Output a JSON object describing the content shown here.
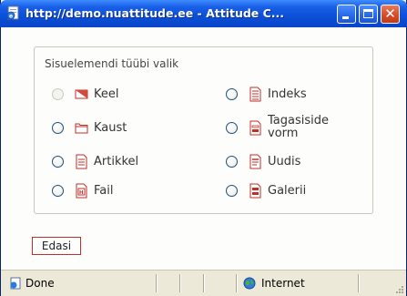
{
  "window": {
    "title": "http://demo.nuattitude.ee - Attitude C...",
    "titlebar_color": "#0b4fd9",
    "close_color": "#d24a26",
    "close_glyph": "✕"
  },
  "form": {
    "legend": "Sisuelemendi tüübi valik",
    "options_left": [
      {
        "label": "Keel",
        "icon": "flag-icon",
        "disabled": true
      },
      {
        "label": "Kaust",
        "icon": "folder-icon",
        "disabled": false
      },
      {
        "label": "Artikkel",
        "icon": "document-icon",
        "disabled": false
      },
      {
        "label": "Fail",
        "icon": "file-icon",
        "disabled": false
      }
    ],
    "options_right": [
      {
        "label": "Indeks",
        "icon": "index-document-icon",
        "disabled": false
      },
      {
        "label": "Tagasiside\nvorm",
        "icon": "feedback-form-icon",
        "disabled": false
      },
      {
        "label": "Uudis",
        "icon": "news-icon",
        "disabled": false
      },
      {
        "label": "Galerii",
        "icon": "gallery-icon",
        "disabled": false
      }
    ],
    "submit_label": "Edasi",
    "accent_color": "#d2302a"
  },
  "statusbar": {
    "status": "Done",
    "zone": "Internet"
  }
}
